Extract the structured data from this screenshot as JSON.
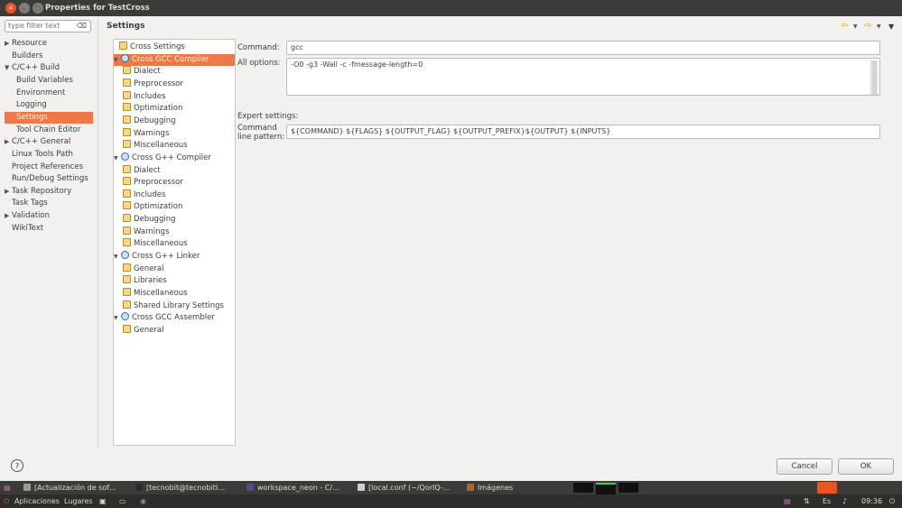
{
  "window": {
    "title": "Properties for TestCross"
  },
  "filter": {
    "placeholder": "type filter text",
    "clear_icon": "⌫"
  },
  "nav": [
    {
      "label": "Resource",
      "arrow": "▶"
    },
    {
      "label": "Builders",
      "arrow": ""
    },
    {
      "label": "C/C++ Build",
      "arrow": "▼"
    },
    {
      "label": "Build Variables",
      "arrow": ""
    },
    {
      "label": "Environment",
      "arrow": ""
    },
    {
      "label": "Logging",
      "arrow": ""
    },
    {
      "label": "Settings",
      "arrow": ""
    },
    {
      "label": "Tool Chain Editor",
      "arrow": ""
    },
    {
      "label": "C/C++ General",
      "arrow": "▶"
    },
    {
      "label": "Linux Tools Path",
      "arrow": ""
    },
    {
      "label": "Project References",
      "arrow": ""
    },
    {
      "label": "Run/Debug Settings",
      "arrow": ""
    },
    {
      "label": "Task Repository",
      "arrow": "▶"
    },
    {
      "label": "Task Tags",
      "arrow": ""
    },
    {
      "label": "Validation",
      "arrow": "▶"
    },
    {
      "label": "WikiText",
      "arrow": ""
    }
  ],
  "header": {
    "title": "Settings"
  },
  "tree": [
    {
      "label": "Cross Settings"
    },
    {
      "label": "Cross GCC Compiler",
      "exp": "▼"
    },
    {
      "label": "Dialect"
    },
    {
      "label": "Preprocessor"
    },
    {
      "label": "Includes"
    },
    {
      "label": "Optimization"
    },
    {
      "label": "Debugging"
    },
    {
      "label": "Warnings"
    },
    {
      "label": "Miscellaneous"
    },
    {
      "label": "Cross G++ Compiler",
      "exp": "▼"
    },
    {
      "label": "Dialect"
    },
    {
      "label": "Preprocessor"
    },
    {
      "label": "Includes"
    },
    {
      "label": "Optimization"
    },
    {
      "label": "Debugging"
    },
    {
      "label": "Warnings"
    },
    {
      "label": "Miscellaneous"
    },
    {
      "label": "Cross G++ Linker",
      "exp": "▼"
    },
    {
      "label": "General"
    },
    {
      "label": "Libraries"
    },
    {
      "label": "Miscellaneous"
    },
    {
      "label": "Shared Library Settings"
    },
    {
      "label": "Cross GCC Assembler",
      "exp": "▼"
    },
    {
      "label": "General"
    }
  ],
  "form": {
    "command_label": "Command:",
    "command_value": "gcc",
    "all_options_label": "All options:",
    "all_options_value": "-O0 -g3 -Wall -c -fmessage-length=0",
    "expert_label": "Expert settings:",
    "pattern_label_1": "Command",
    "pattern_label_2": "line pattern:",
    "pattern_value": "${COMMAND} ${FLAGS} ${OUTPUT_FLAG} ${OUTPUT_PREFIX}${OUTPUT} ${INPUTS}"
  },
  "buttons": {
    "cancel": "Cancel",
    "ok": "OK",
    "help": "?"
  },
  "taskbar": [
    {
      "label": "[Actualización de sof…",
      "color": "#9a9a9a"
    },
    {
      "label": "[tecnobit@tecnobitI…",
      "color": "#2b2b2b"
    },
    {
      "label": "workspace_neon - C/…",
      "color": "#5a4a8a"
    },
    {
      "label": "[local.conf (~/QorIQ-…",
      "color": "#cfcfcf"
    },
    {
      "label": "Imágenes",
      "color": "#a06a3a"
    }
  ],
  "panel": {
    "apps": "Aplicaciones",
    "places": "Lugares",
    "lang": "Es",
    "time": "09:36"
  },
  "colors": {
    "accent": "#f07746",
    "titlebar": "#3c3b37"
  }
}
